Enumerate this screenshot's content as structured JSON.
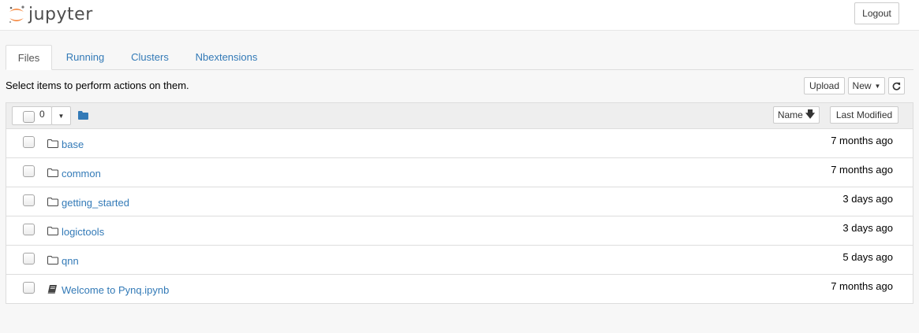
{
  "header": {
    "logo_text": "jupyter",
    "logout_label": "Logout"
  },
  "tabs": [
    {
      "label": "Files",
      "active": true
    },
    {
      "label": "Running",
      "active": false
    },
    {
      "label": "Clusters",
      "active": false
    },
    {
      "label": "Nbextensions",
      "active": false
    }
  ],
  "toolbar": {
    "hint": "Select items to perform actions on them.",
    "upload_label": "Upload",
    "new_label": "New",
    "refresh_icon": "refresh-icon"
  },
  "list_header": {
    "selected_count": "0",
    "name_label": "Name",
    "last_modified_label": "Last Modified"
  },
  "items": [
    {
      "name": "base",
      "type": "folder",
      "modified": "7 months ago"
    },
    {
      "name": "common",
      "type": "folder",
      "modified": "7 months ago"
    },
    {
      "name": "getting_started",
      "type": "folder",
      "modified": "3 days ago"
    },
    {
      "name": "logictools",
      "type": "folder",
      "modified": "3 days ago"
    },
    {
      "name": "qnn",
      "type": "folder",
      "modified": "5 days ago"
    },
    {
      "name": "Welcome to Pynq.ipynb",
      "type": "notebook",
      "modified": "7 months ago"
    }
  ],
  "colors": {
    "link": "#337ab7",
    "jupyter_orange": "#f37726"
  }
}
